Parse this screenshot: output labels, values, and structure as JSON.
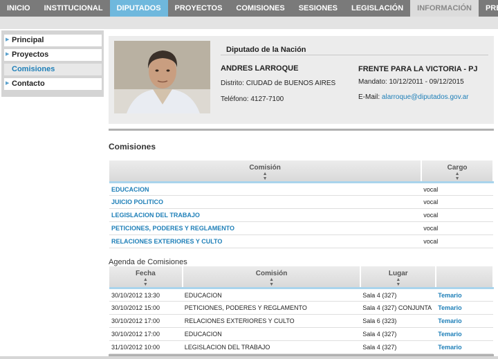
{
  "nav": {
    "tabs": [
      {
        "label": "INICIO"
      },
      {
        "label": "INSTITUCIONAL"
      },
      {
        "label": "DIPUTADOS"
      },
      {
        "label": "PROYECTOS"
      },
      {
        "label": "COMISIONES"
      },
      {
        "label": "SESIONES"
      },
      {
        "label": "LEGISLACIÓN"
      },
      {
        "label": "INFORMACIÓN"
      },
      {
        "label": "PRENSA"
      }
    ],
    "active": "DIPUTADOS"
  },
  "sidebar": {
    "items": [
      {
        "label": "Principal"
      },
      {
        "label": "Proyectos"
      },
      {
        "label": "Comisiones"
      },
      {
        "label": "Contacto"
      }
    ],
    "active": "Comisiones"
  },
  "profile": {
    "role": "Diputado de la Nación",
    "name": "ANDRES LARROQUE",
    "distrito_label": "Distrito:",
    "distrito_value": "CIUDAD de BUENOS AIRES",
    "telefono_label": "Teléfono:",
    "telefono_value": "4127-7100",
    "bloque": "FRENTE PARA LA VICTORIA - PJ",
    "mandato_label": "Mandato:",
    "mandato_value": "10/12/2011 - 09/12/2015",
    "email_label": "E-Mail:",
    "email_value": "alarroque@diputados.gov.ar"
  },
  "comisiones": {
    "title": "Comisiones",
    "headers": [
      "Comisión",
      "Cargo"
    ],
    "rows": [
      {
        "comision": "EDUCACION",
        "cargo": "vocal"
      },
      {
        "comision": "JUICIO POLITICO",
        "cargo": "vocal"
      },
      {
        "comision": "LEGISLACION DEL TRABAJO",
        "cargo": "vocal"
      },
      {
        "comision": "PETICIONES, PODERES Y REGLAMENTO",
        "cargo": "vocal"
      },
      {
        "comision": "RELACIONES EXTERIORES Y CULTO",
        "cargo": "vocal"
      }
    ]
  },
  "agenda": {
    "title": "Agenda de Comisiones",
    "headers": [
      "Fecha",
      "Comisión",
      "Lugar",
      ""
    ],
    "rows": [
      {
        "fecha": "30/10/2012 13:30",
        "comision": "EDUCACION",
        "lugar": "Sala 4 (327)",
        "link": "Temario"
      },
      {
        "fecha": "30/10/2012 15:00",
        "comision": "PETICIONES, PODERES Y REGLAMENTO",
        "lugar": "Sala 4 (327) CONJUNTA",
        "link": "Temario"
      },
      {
        "fecha": "30/10/2012 17:00",
        "comision": "RELACIONES EXTERIORES Y CULTO",
        "lugar": "Sala 6 (323)",
        "link": "Temario"
      },
      {
        "fecha": "30/10/2012 17:00",
        "comision": "EDUCACION",
        "lugar": "Sala 4 (327)",
        "link": "Temario"
      },
      {
        "fecha": "31/10/2012 10:00",
        "comision": "LEGISLACION DEL TRABAJO",
        "lugar": "Sala 4 (327)",
        "link": "Temario"
      }
    ]
  },
  "colors": {
    "nav_bg": "#7a7a7a",
    "nav_active": "#6fb8dd",
    "link": "#1e7fb8"
  }
}
